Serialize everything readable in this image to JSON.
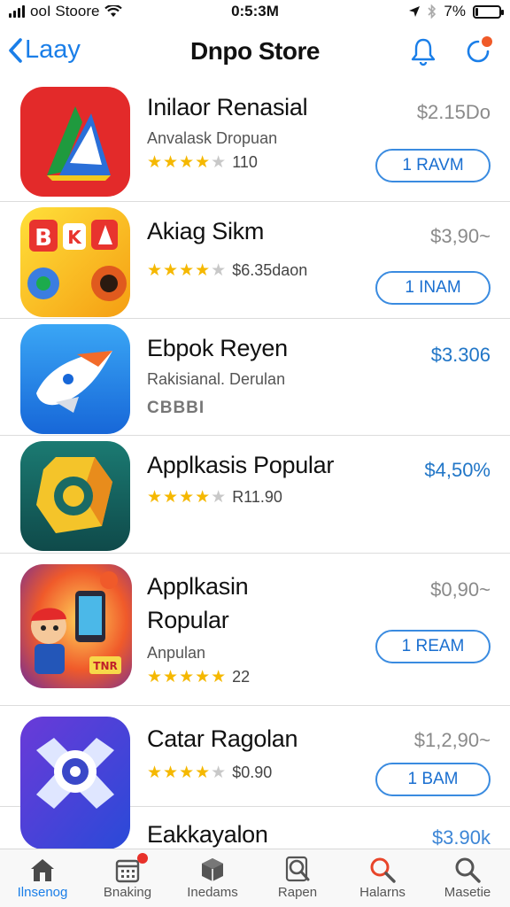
{
  "status": {
    "carrier": "ooI Stoore",
    "time": "0:5:3M",
    "battery": "7%",
    "battery_level": 0.07
  },
  "nav": {
    "back_label": "Laay",
    "title": "Dnpo Store"
  },
  "apps": [
    {
      "name": "Inilaor Renasial",
      "subtitle": "Anvalask Dropuan",
      "rating_text": "110",
      "price": "$2.15Do",
      "button": "1 RAVM",
      "rating": 4.5
    },
    {
      "name": "Akiag Sikm",
      "rating_text": "$6.35daon",
      "price": "$3,90~",
      "button": "1 INAM",
      "rating": 4.5
    },
    {
      "name": "Ebpok Reyen",
      "subtitle": "Rakisianal. Derulan",
      "code": "CBBBI",
      "price": "$3.306"
    },
    {
      "name": "Applkasis Popular",
      "rating_text": "R11.90",
      "price": "$4,50%",
      "rating": 4.5
    },
    {
      "name_line1": "Applkasin",
      "name_line2": "Ropular",
      "subtitle": "Anpulan",
      "rating_text": "22",
      "price": "$0,90~",
      "button": "1 REAM",
      "rating": 5
    },
    {
      "name": "Catar Ragolan",
      "rating_text": "$0.90",
      "price": "$1,2,90~",
      "button": "1 BAM",
      "rating": 4
    },
    {
      "name": "Eakkayalon",
      "price": "$3.90k"
    }
  ],
  "tabs": [
    {
      "label": "Ilnsenog",
      "icon": "home-icon",
      "active": true
    },
    {
      "label": "Bnaking",
      "icon": "calendar-icon",
      "badge": true
    },
    {
      "label": "Inedams",
      "icon": "cube-icon"
    },
    {
      "label": "Rapen",
      "icon": "search-doc-icon"
    },
    {
      "label": "Halarns",
      "icon": "search-icon"
    },
    {
      "label": "Masetie",
      "icon": "search-icon"
    }
  ],
  "colors": {
    "accent": "#1a7ee8",
    "star": "#f5b800",
    "price_gray": "#8a8a8a",
    "price_blue": "#2176c7"
  }
}
